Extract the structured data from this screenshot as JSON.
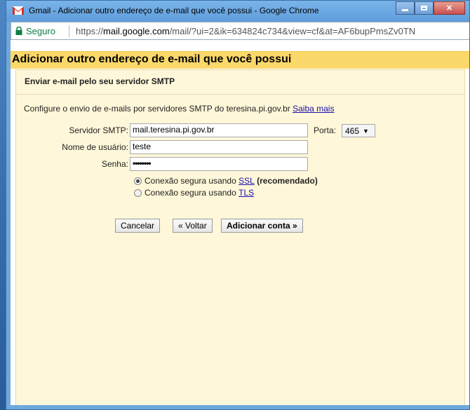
{
  "window": {
    "title": "Gmail - Adicionar outro endereço de e-mail que você possui - Google Chrome"
  },
  "address_bar": {
    "secure_label": "Seguro",
    "url_prefix": "https://",
    "url_host": "mail.google.com",
    "url_path": "/mail/?ui=2&ik=634824c734&view=cf&at=AF6bupPmsZv0TN"
  },
  "page": {
    "header_title": "Adicionar outro endereço de e-mail que você possui",
    "section_title": "Enviar e-mail pelo seu servidor SMTP",
    "description": "Configure o envio de e-mails por servidores SMTP do teresina.pi.gov.br",
    "learn_more": "Saiba mais"
  },
  "form": {
    "smtp_label": "Servidor SMTP:",
    "smtp_value": "mail.teresina.pi.gov.br",
    "port_label": "Porta:",
    "port_value": "465",
    "username_label": "Nome de usuário:",
    "username_value": "teste",
    "password_label": "Senha:",
    "password_value": "••••••••",
    "ssl_prefix": "Conexão segura usando",
    "ssl_link": "SSL",
    "ssl_suffix": "(recomendado)",
    "tls_prefix": "Conexão segura usando",
    "tls_link": "TLS"
  },
  "buttons": {
    "cancel": "Cancelar",
    "back": "« Voltar",
    "add": "Adicionar conta »"
  },
  "colors": {
    "header_bg": "#fbd86a",
    "panel_bg": "#fff7d9",
    "link": "#1a0dab",
    "secure": "#0b8043"
  }
}
